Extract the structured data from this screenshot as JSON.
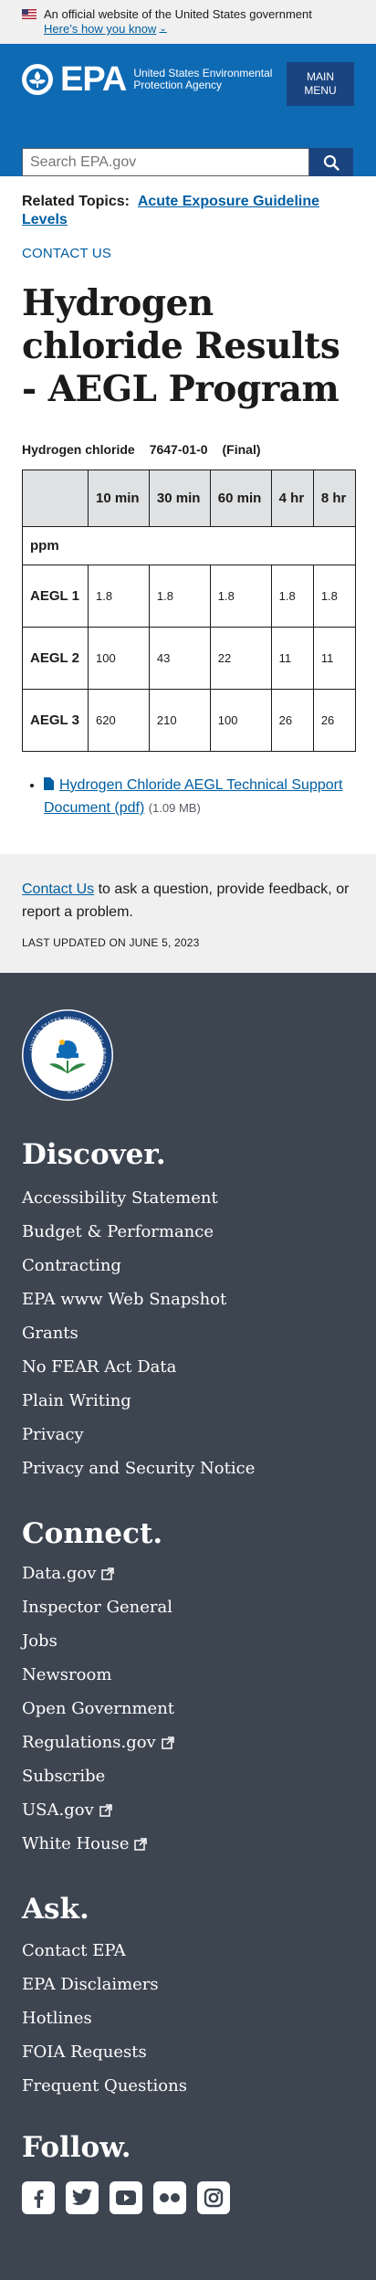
{
  "gov_banner": {
    "official_text": "An official website of the United States government",
    "how_know_link": "Here’s how you know"
  },
  "header": {
    "logo_text": "EPA",
    "agency_name": "United States Environmental Protection Agency",
    "menu_label_1": "Main",
    "menu_label_2": "Menu",
    "search_placeholder": "Search EPA.gov"
  },
  "related": {
    "label": "Related Topics:",
    "link": "Acute Exposure Guideline Levels"
  },
  "contact_us_top": "CONTACT US",
  "page_title": "Hydrogen chloride Results - AEGL Program",
  "chemical": {
    "name": "Hydrogen chloride",
    "cas": "7647-01-0",
    "status": "(Final)"
  },
  "table": {
    "headers": [
      "",
      "10 min",
      "30 min",
      "60 min",
      "4 hr",
      "8 hr"
    ],
    "unit_row": "ppm",
    "rows": [
      {
        "label": "AEGL 1",
        "values": [
          "1.8",
          "1.8",
          "1.8",
          "1.8",
          "1.8"
        ]
      },
      {
        "label": "AEGL 2",
        "values": [
          "100",
          "43",
          "22",
          "11",
          "11"
        ]
      },
      {
        "label": "AEGL 3",
        "values": [
          "620",
          "210",
          "100",
          "26",
          "26"
        ]
      }
    ]
  },
  "documents": [
    {
      "title": "Hydrogen Chloride AEGL Technical Support Document (pdf)",
      "size": "(1.09 MB)",
      "icon": "file-icon"
    }
  ],
  "contact_box": {
    "link": "Contact Us",
    "text": " to ask a question, provide feedback, or report a problem.",
    "last_updated": "LAST UPDATED ON JUNE 5, 2023"
  },
  "footer": {
    "seal_text": "UNITED STATES ENVIRONMENTAL PROTECTION AGENCY",
    "discover": {
      "heading": "Discover.",
      "items": [
        "Accessibility Statement",
        "Budget & Performance",
        "Contracting",
        "EPA www Web Snapshot",
        "Grants",
        "No FEAR Act Data",
        "Plain Writing",
        "Privacy",
        "Privacy and Security Notice"
      ]
    },
    "connect": {
      "heading": "Connect.",
      "items": [
        {
          "label": "Data.gov",
          "external": true
        },
        {
          "label": "Inspector General",
          "external": false
        },
        {
          "label": "Jobs",
          "external": false
        },
        {
          "label": "Newsroom",
          "external": false
        },
        {
          "label": "Open Government",
          "external": false
        },
        {
          "label": "Regulations.gov",
          "external": true
        },
        {
          "label": "Subscribe",
          "external": false
        },
        {
          "label": "USA.gov",
          "external": true
        },
        {
          "label": "White House",
          "external": true
        }
      ]
    },
    "ask": {
      "heading": "Ask.",
      "items": [
        "Contact EPA",
        "EPA Disclaimers",
        "Hotlines",
        "FOIA Requests",
        "Frequent Questions"
      ]
    },
    "follow": {
      "heading": "Follow.",
      "social_icons": [
        "facebook-icon",
        "twitter-icon",
        "youtube-icon",
        "flickr-icon",
        "instagram-icon"
      ]
    }
  },
  "colors": {
    "header_blue": "#0f6ab4",
    "dark_blue": "#1a4480",
    "link_blue": "#005ea2",
    "footer_bg": "#3d4551",
    "light_gray": "#f0f0f0"
  }
}
